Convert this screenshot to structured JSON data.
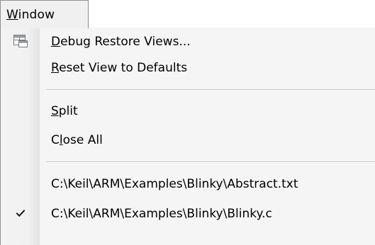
{
  "menubar": {
    "active_menu": "Window",
    "active_menu_mnemonic": "W"
  },
  "menu": {
    "items": [
      {
        "id": "debug-restore-views",
        "mnemonic": "D",
        "rest": "ebug Restore Views...",
        "icon": "window-layout-icon",
        "checked": false
      },
      {
        "id": "reset-view-defaults",
        "mnemonic": "R",
        "rest": "eset View to Defaults",
        "icon": "",
        "checked": false
      },
      {
        "id": "split",
        "mnemonic": "S",
        "rest": "plit",
        "icon": "",
        "checked": false
      },
      {
        "id": "close-all",
        "prefix": "C",
        "mnemonic": "l",
        "rest": "ose All",
        "icon": "",
        "checked": false
      },
      {
        "id": "recent-abstract",
        "label": "C:\\Keil\\ARM\\Examples\\Blinky\\Abstract.txt",
        "icon": "",
        "checked": false
      },
      {
        "id": "recent-blinky",
        "label": "C:\\Keil\\ARM\\Examples\\Blinky\\Blinky.c",
        "icon": "checkmark-icon",
        "checked": true
      }
    ]
  }
}
